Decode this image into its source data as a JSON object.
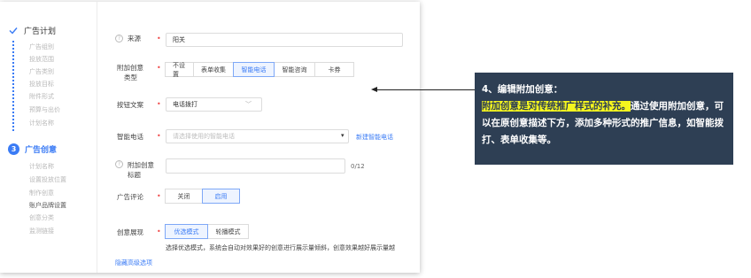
{
  "sidebar": {
    "steps": [
      {
        "title": "广告计划",
        "subs": [
          "广告组别",
          "投放范围",
          "广告类别",
          "投放目标",
          "附件形式",
          "预算与出价",
          "计划名称"
        ]
      },
      {
        "number": "3",
        "title": "广告创意",
        "subs": [
          "计划名称",
          "设置投放位置",
          "制作创意",
          "账户品牌设置",
          "创意分类",
          "监测链接"
        ]
      }
    ]
  },
  "form": {
    "source": {
      "label": "来源",
      "value": "阳关"
    },
    "creative_type": {
      "label": "附加创意类型",
      "label_line1": "附加创意",
      "label_line2": "类型",
      "options": [
        "不设置",
        "表单收集",
        "智能电话",
        "智能咨询",
        "卡券"
      ],
      "selected": "智能电话"
    },
    "button_text": {
      "label": "按钮文案",
      "value": "电话拨打"
    },
    "smart_phone": {
      "label": "智能电话",
      "placeholder": "请选择使用的智能电话",
      "new_link": "新建智能电话"
    },
    "creative_title": {
      "label_line1": "附加创意",
      "label_line2": "标题",
      "counter": "0/12"
    },
    "comment": {
      "label": "广告评论",
      "options": [
        "关闭",
        "启用"
      ],
      "selected": "启用"
    },
    "display": {
      "label": "创意展现",
      "options": [
        "优选模式",
        "轮播模式"
      ],
      "selected": "优选模式",
      "hint": "选择优选模式，系统会自动对效果好的创意进行展示量倾斜，创意效果越好展示量越"
    },
    "advanced_link": "隐藏高级选项"
  },
  "callout": {
    "heading": "4、编辑附加创意：",
    "highlight": "附加创意是对传统推广样式的补充。",
    "rest": "通过使用附加创意，可以在原创意描述下方，添加多种形式的推广信息，如智能拨打、表单收集等。"
  },
  "colors": {
    "accent": "#3a7bf5",
    "callout_bg": "#2e3f54",
    "highlight": "#f4f51e",
    "required": "#f04a4a"
  }
}
